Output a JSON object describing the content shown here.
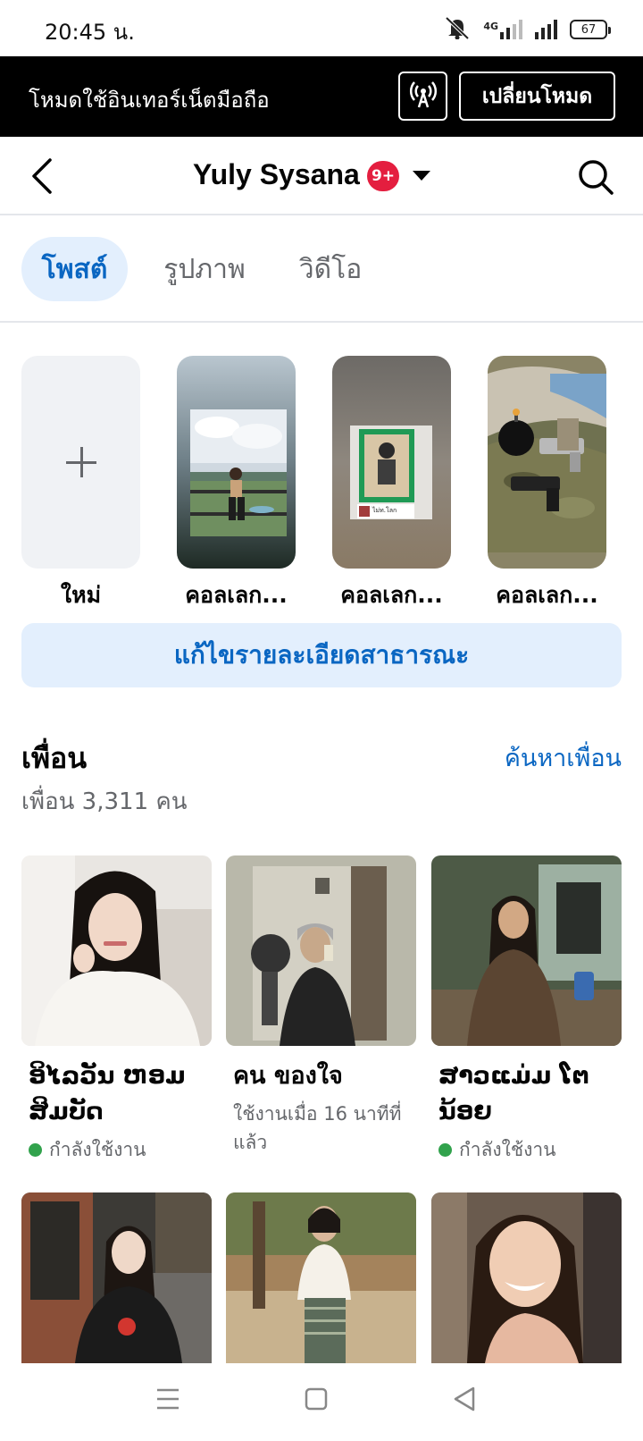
{
  "status_bar": {
    "time": "20:45 น.",
    "network_type": "4G",
    "battery_level": "67",
    "icons": [
      "mute-icon",
      "signal-4g-icon",
      "signal-icon",
      "battery-icon"
    ]
  },
  "banner": {
    "text": "โหมดใช้อินเทอร์เน็ตมือถือ",
    "icon": "broadcast-icon",
    "switch_label": "เปลี่ยนโหมด"
  },
  "header": {
    "title": "Yuly Sysana",
    "badge": "9+",
    "accent_badge": "#e41e3f"
  },
  "tabs": [
    {
      "label": "โพสต์",
      "active": true
    },
    {
      "label": "รูปภาพ",
      "active": false
    },
    {
      "label": "วิดีโอ",
      "active": false
    }
  ],
  "collections": [
    {
      "label": "ใหม่"
    },
    {
      "label": "คอลเลก..."
    },
    {
      "label": "คอลเลก..."
    },
    {
      "label": "คอลเลก..."
    }
  ],
  "collection_photo_caption": "ไม่ท.โลก",
  "edit_details_label": "แก้ไขรายละเอียดสาธารณะ",
  "friends": {
    "title": "เพื่อน",
    "find_label": "ค้นหาเพื่อน",
    "count_text": "เพื่อน 3,311 คน",
    "items": [
      {
        "name": "ອິໄລວັນ ຫອມ ສິມບັດ",
        "status": "กำลังใช้งาน",
        "online": true
      },
      {
        "name": "คน ของใจ",
        "status": "ใช้งานเมื่อ 16 นาทีที่แล้ว",
        "online": false
      },
      {
        "name": "ສາວແມ່ມ ໂຕ ນ້ອຍ",
        "status": "กำลังใช้งาน",
        "online": true
      },
      {
        "name": "",
        "status": "",
        "online": false
      },
      {
        "name": "",
        "status": "",
        "online": false
      },
      {
        "name": "",
        "status": "",
        "online": false
      }
    ]
  },
  "colors": {
    "accent_blue": "#0a66c2",
    "tab_active_bg": "#e3effd",
    "online_green": "#31a24c"
  }
}
